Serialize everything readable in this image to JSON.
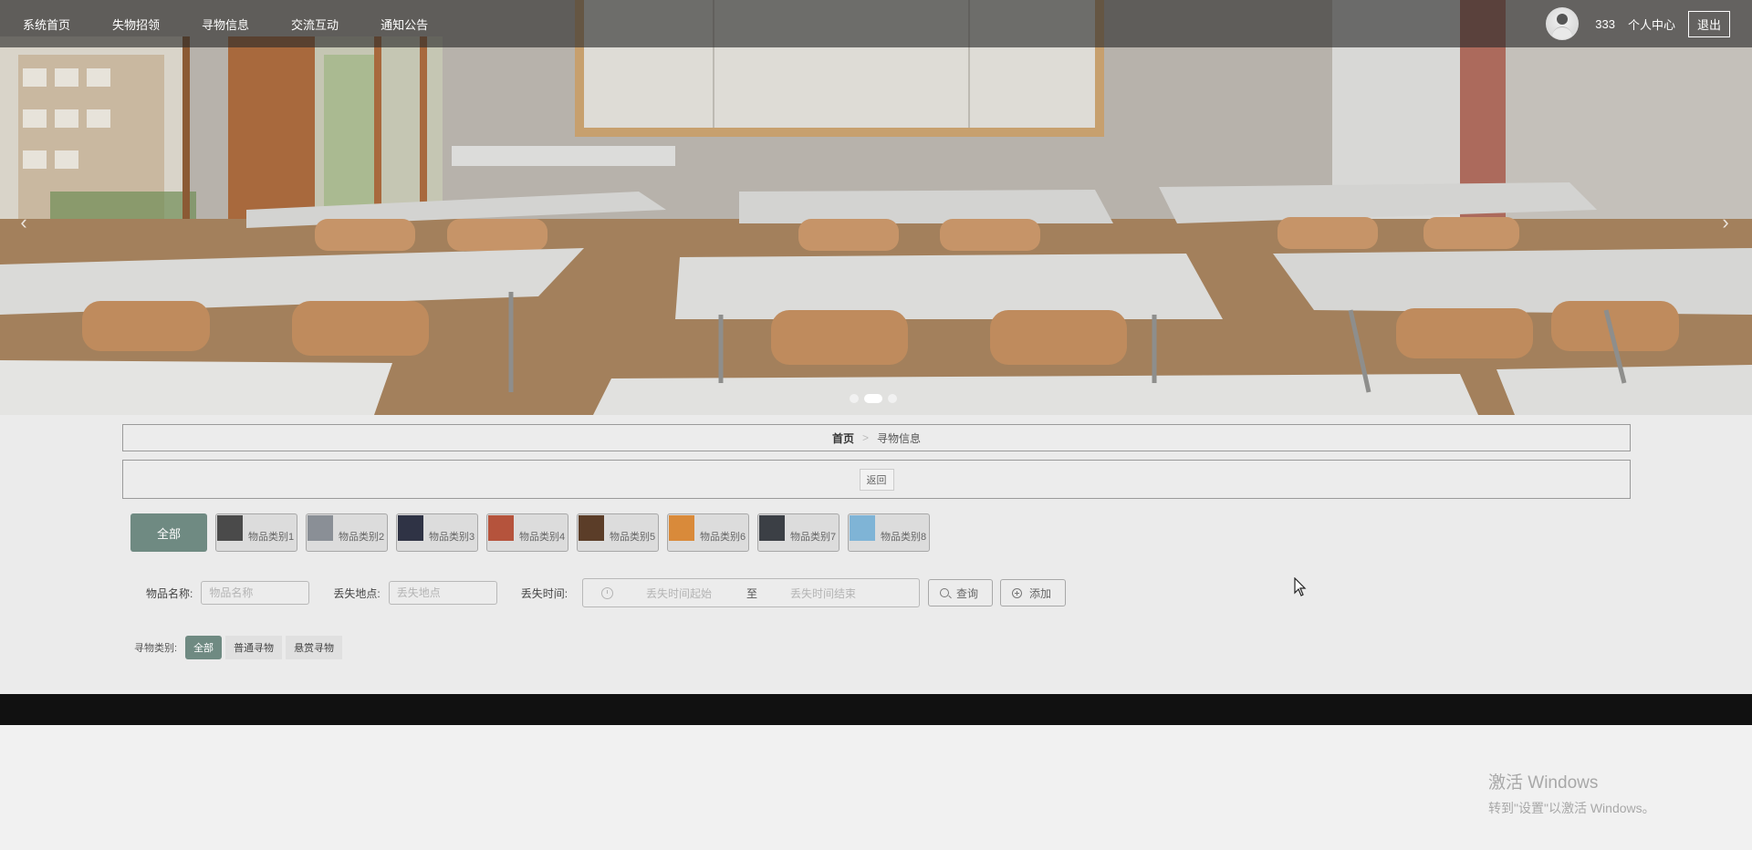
{
  "nav": {
    "items": [
      {
        "label": "系统首页"
      },
      {
        "label": "失物招领"
      },
      {
        "label": "寻物信息"
      },
      {
        "label": "交流互动"
      },
      {
        "label": "通知公告"
      }
    ],
    "user_name": "333",
    "personal_center": "个人中心",
    "logout": "退出"
  },
  "carousel": {
    "prev_glyph": "‹",
    "next_glyph": "›",
    "slide_count": 3,
    "active_index": 1
  },
  "breadcrumb": {
    "home": "首页",
    "separator": ">",
    "current": "寻物信息"
  },
  "back_button": "返回",
  "categories": {
    "all_label": "全部",
    "items": [
      {
        "label": "物品类别1",
        "thumb_color": "#4a4a4a"
      },
      {
        "label": "物品类别2",
        "thumb_color": "#8a8f96"
      },
      {
        "label": "物品类别3",
        "thumb_color": "#2f3345"
      },
      {
        "label": "物品类别4",
        "thumb_color": "#b5533c"
      },
      {
        "label": "物品类别5",
        "thumb_color": "#5b3d28"
      },
      {
        "label": "物品类别6",
        "thumb_color": "#d98a3a"
      },
      {
        "label": "物品类别7",
        "thumb_color": "#3b3f45"
      },
      {
        "label": "物品类别8",
        "thumb_color": "#7fb4d6"
      }
    ]
  },
  "search": {
    "name_label": "物品名称:",
    "name_placeholder": "物品名称",
    "place_label": "丢失地点:",
    "place_placeholder": "丢失地点",
    "time_label": "丢失时间:",
    "time_start_placeholder": "丢失时间起始",
    "time_to": "至",
    "time_end_placeholder": "丢失时间结束",
    "query_button": "查询",
    "add_button": "添加"
  },
  "filter": {
    "label": "寻物类别:",
    "options": [
      {
        "label": "全部",
        "active": true
      },
      {
        "label": "普通寻物",
        "active": false
      },
      {
        "label": "悬赏寻物",
        "active": false
      }
    ]
  },
  "watermark": {
    "title": "激活 Windows",
    "subtitle": "转到\"设置\"以激活 Windows。"
  },
  "colors": {
    "accent": "#6f8a82",
    "nav_bg": "rgba(40,40,40,0.62)",
    "footer": "#111111",
    "page_bg": "#ebebeb"
  }
}
